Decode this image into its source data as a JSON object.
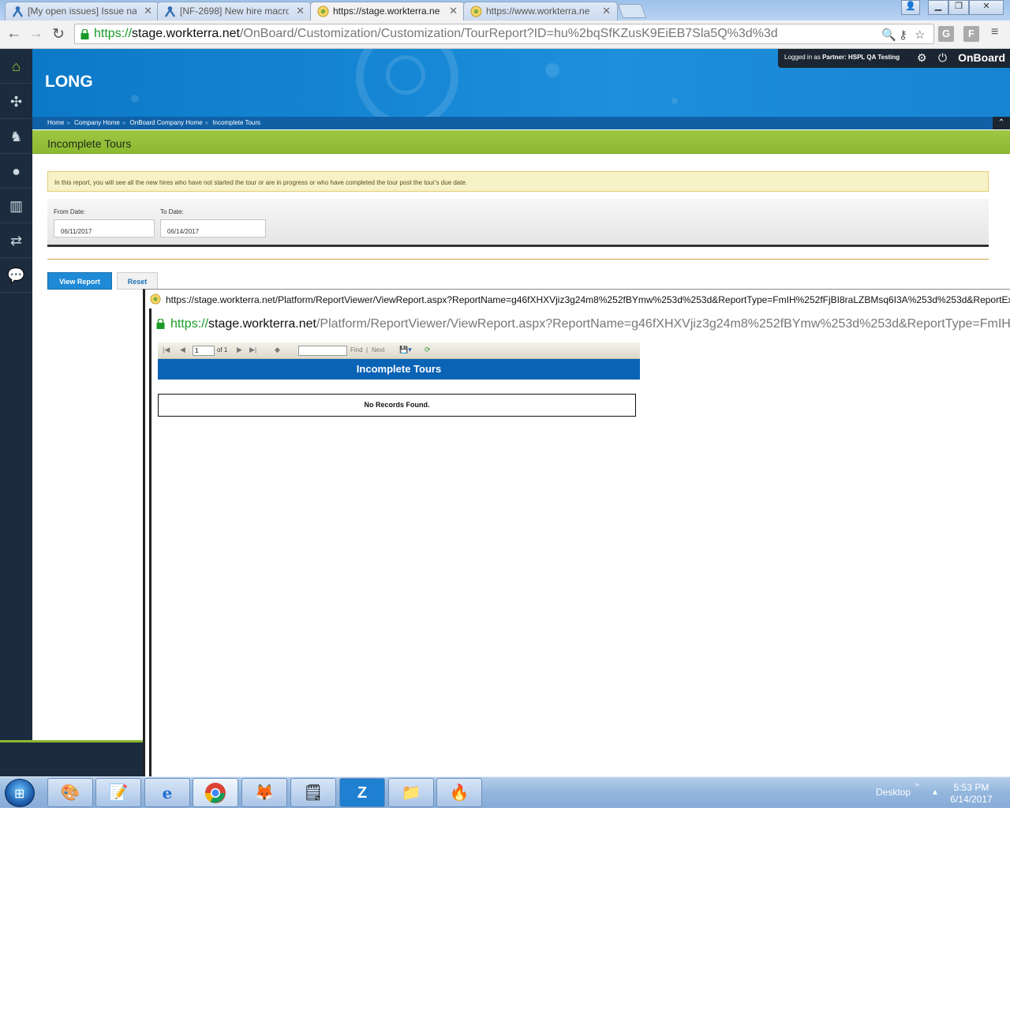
{
  "browser": {
    "tabs": [
      {
        "title": "[My open issues] Issue na",
        "icon": "jira-icon"
      },
      {
        "title": "[NF-2698] New hire macro",
        "icon": "jira-icon"
      },
      {
        "title": "https://stage.workterra.ne",
        "icon": "workterra-icon"
      },
      {
        "title": "https://www.workterra.ne",
        "icon": "workterra-icon"
      }
    ],
    "address": {
      "scheme": "https://",
      "host": "stage.workterra.net",
      "path": "/OnBoard/Customization/Customization/TourReport?ID=hu%2bqSfKZusK9EiEB7Sla5Q%3d%3d"
    },
    "ext1": "G",
    "ext2": "F"
  },
  "app": {
    "company": "LONG",
    "logged_in_prefix": "Logged in as",
    "logged_in_role": "Partner:",
    "logged_in_name": "HSPL QA Testing",
    "brand": "OnBoard",
    "breadcrumb": [
      "Home",
      "Company Home",
      "OnBoard Company Home",
      "Incomplete Tours"
    ],
    "page_title": "Incomplete Tours",
    "info_note": "In this report, you will see all the new hires who have not started the tour or are in progress or who have completed the tour post the tour's due date.",
    "filters": {
      "from_label": "From Date:",
      "from_value": "06/11/2017",
      "to_label": "To Date:",
      "to_value": "06/14/2017"
    },
    "buttons": {
      "view": "View Report",
      "reset": "Reset"
    }
  },
  "popup": {
    "title_url": "https://stage.workterra.net/Platform/ReportViewer/ViewReport.aspx?ReportName=g46fXHXVjiz3g24m8%252fBYmw%253d%253d&ReportType=FmIH%252fFjBI8raLZBMsq6I3A%253d%253d&ReportExp",
    "address": {
      "scheme": "https://",
      "host": "stage.workterra.net",
      "path": "/Platform/ReportViewer/ViewReport.aspx?ReportName=g46fXHXVjiz3g24m8%252fBYmw%253d%253d&ReportType=FmIH%"
    },
    "toolbar": {
      "page_value": "1",
      "of_label": "of 1",
      "find_label": "Find",
      "sep": "|",
      "next_label": "Next"
    },
    "report_title": "Incomplete Tours",
    "empty_message": "No Records Found."
  },
  "taskbar": {
    "show_desktop": "Desktop",
    "chevron": "»",
    "time": "5:53 PM",
    "date": "6/14/2017",
    "apps": [
      "paint-icon",
      "notepad-icon",
      "internet-explorer-icon",
      "chrome-icon",
      "firefox-icon",
      "sticky-notes-icon",
      "zoho-icon",
      "file-explorer-icon",
      "burner-icon"
    ]
  }
}
